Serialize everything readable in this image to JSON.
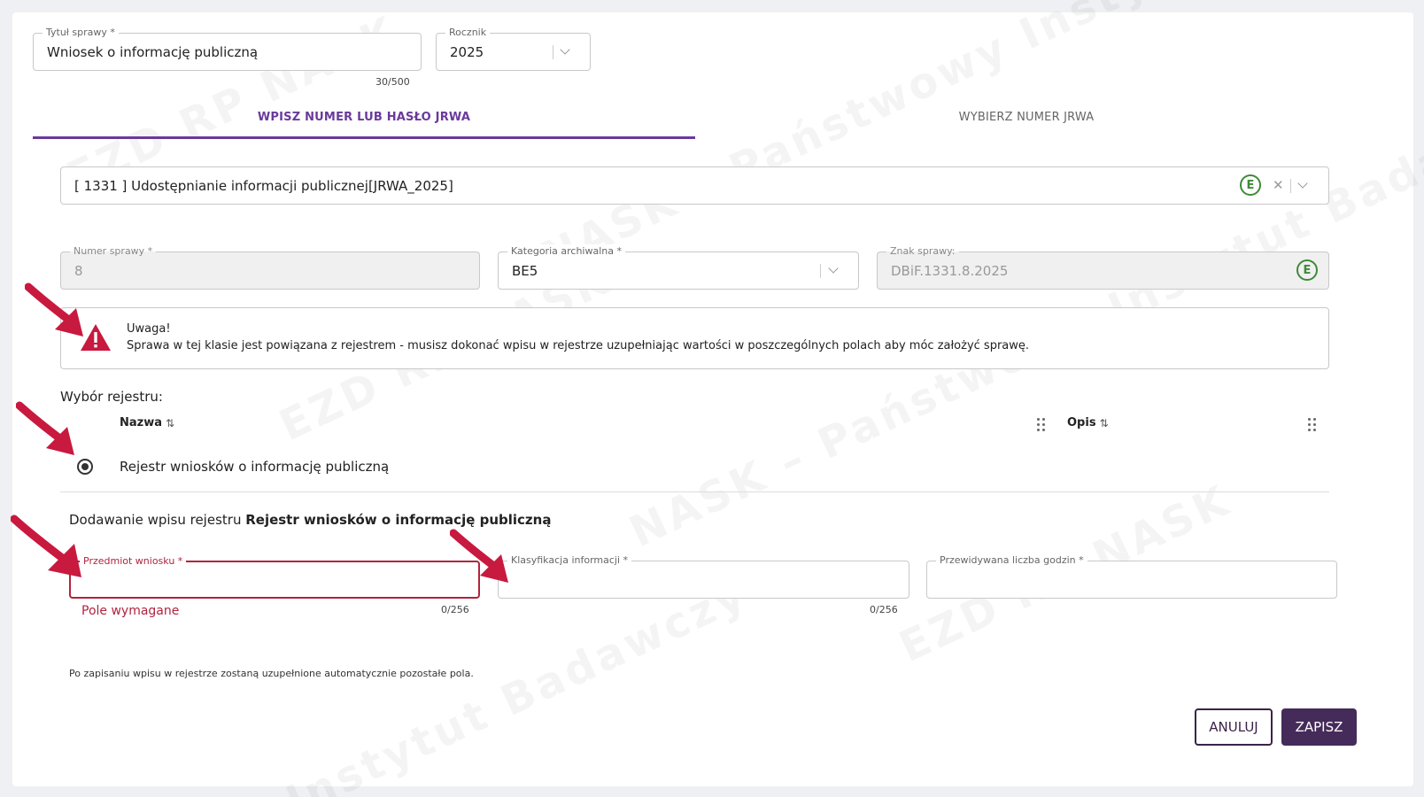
{
  "case_title": {
    "label": "Tytuł sprawy *",
    "value": "Wniosek o informację publiczną",
    "counter": "30/500"
  },
  "year": {
    "label": "Rocznik",
    "value": "2025"
  },
  "tabs": {
    "enter": "WPISZ NUMER LUB HASŁO JRWA",
    "choose": "WYBIERZ NUMER JRWA"
  },
  "jrwa_select": {
    "value": "[ 1331 ] Udostępnianie informacji publicznej[JRWA_2025]",
    "e_badge": "E",
    "clear_icon": "✕"
  },
  "case_number": {
    "label": "Numer sprawy *",
    "value": "8"
  },
  "archive_category": {
    "label": "Kategoria archiwalna *",
    "value": "BE5"
  },
  "case_sign": {
    "label": "Znak sprawy:",
    "value": "DBiF.1331.8.2025",
    "e_badge": "E"
  },
  "alert": {
    "title": "Uwaga!",
    "message": "Sprawa w tej klasie jest powiązana z rejestrem - musisz dokonać wpisu w rejestrze uzupełniając wartości w poszczególnych polach aby móc założyć sprawę.",
    "icon": "warning-triangle"
  },
  "registry": {
    "section_label": "Wybór rejestru:",
    "col_name": "Nazwa",
    "col_desc": "Opis",
    "sort_icon": "⇅",
    "row_name": "Rejestr wniosków o informację publiczną"
  },
  "entry": {
    "prefix": "Dodawanie wpisu rejestru ",
    "registry_name": "Rejestr wniosków o informację publiczną",
    "subject": {
      "label": "Przedmiot wniosku *",
      "value": "",
      "counter": "0/256",
      "error": "Pole wymagane"
    },
    "classification": {
      "label": "Klasyfikacja informacji *",
      "value": "",
      "counter": "0/256"
    },
    "hours": {
      "label": "Przewidywana liczba godzin *",
      "value": ""
    },
    "note": "Po zapisaniu wpisu w rejestrze zostaną uzupełnione automatycznie pozostałe pola."
  },
  "buttons": {
    "cancel": "ANULUJ",
    "save": "ZAPISZ"
  },
  "colors": {
    "accent": "#6a3a9b",
    "error": "#b2233e",
    "primary_button": "#452b5a",
    "badge_green": "#3d8b37",
    "annotation_arrow": "#c8193f"
  }
}
